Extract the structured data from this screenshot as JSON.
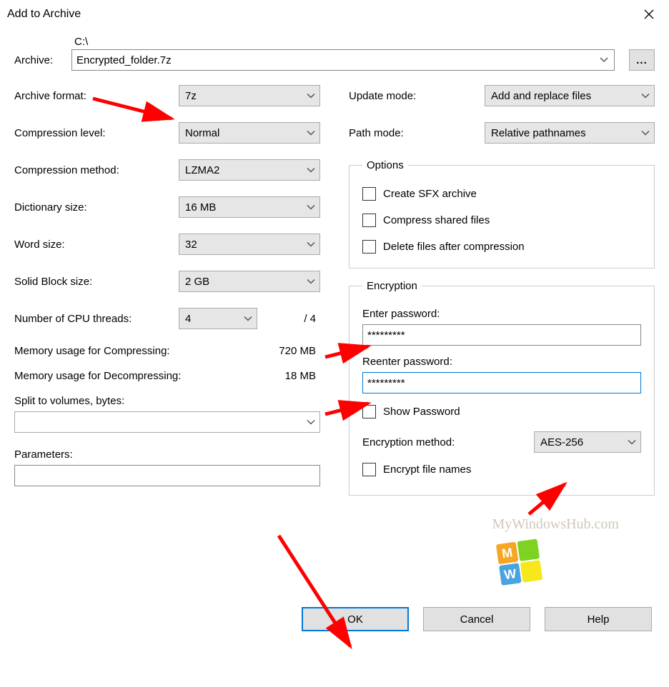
{
  "window": {
    "title": "Add to Archive"
  },
  "archive": {
    "label": "Archive:",
    "path": "C:\\",
    "filename": "Encrypted_folder.7z",
    "browse": "..."
  },
  "left": {
    "format": {
      "label": "Archive format:",
      "value": "7z"
    },
    "level": {
      "label": "Compression level:",
      "value": "Normal"
    },
    "method": {
      "label": "Compression method:",
      "value": "LZMA2"
    },
    "dict": {
      "label": "Dictionary size:",
      "value": "16 MB"
    },
    "word": {
      "label": "Word size:",
      "value": "32"
    },
    "solid": {
      "label": "Solid Block size:",
      "value": "2 GB"
    },
    "cpu": {
      "label": "Number of CPU threads:",
      "value": "4",
      "total": "/ 4"
    },
    "mem_compress": {
      "label": "Memory usage for Compressing:",
      "value": "720 MB"
    },
    "mem_decompress": {
      "label": "Memory usage for Decompressing:",
      "value": "18 MB"
    },
    "split": {
      "label": "Split to volumes, bytes:",
      "value": ""
    },
    "params": {
      "label": "Parameters:",
      "value": ""
    }
  },
  "right": {
    "update": {
      "label": "Update mode:",
      "value": "Add and replace files"
    },
    "pathmode": {
      "label": "Path mode:",
      "value": "Relative pathnames"
    },
    "options": {
      "legend": "Options",
      "sfx": "Create SFX archive",
      "shared": "Compress shared files",
      "delete": "Delete files after compression"
    },
    "encryption": {
      "legend": "Encryption",
      "enter": "Enter password:",
      "password1": "*********",
      "reenter": "Reenter password:",
      "password2": "*********",
      "show": "Show Password",
      "method_label": "Encryption method:",
      "method_value": "AES-256",
      "encrypt_names": "Encrypt file names"
    }
  },
  "buttons": {
    "ok": "OK",
    "cancel": "Cancel",
    "help": "Help"
  },
  "watermark": "MyWindowsHub.com",
  "annotations": {
    "arrows": [
      "archive-format",
      "enter-password",
      "reenter-password",
      "encryption-method",
      "ok-button"
    ]
  }
}
